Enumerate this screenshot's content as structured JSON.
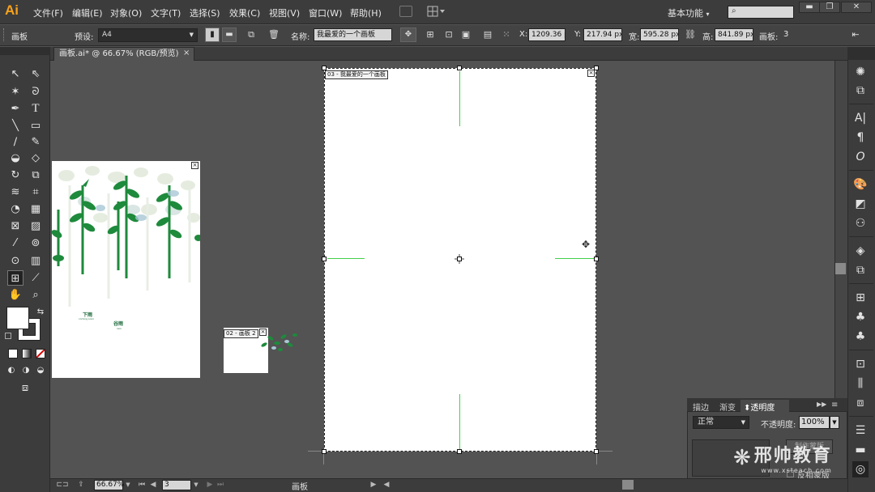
{
  "app": {
    "logo": "Ai"
  },
  "menu": [
    "文件(F)",
    "编辑(E)",
    "对象(O)",
    "文字(T)",
    "选择(S)",
    "效果(C)",
    "视图(V)",
    "窗口(W)",
    "帮助(H)"
  ],
  "workspace": "基本功能",
  "search": {
    "placeholder": ""
  },
  "window_controls": {
    "minimize": "▬",
    "maximize": "❐",
    "close": "✕"
  },
  "control_bar": {
    "mode": "画板",
    "preset_label": "预设:",
    "preset_value": "A4",
    "name_label": "名称:",
    "name_value": "我最爱的一个画板",
    "x_label": "X:",
    "x_value": "1209.36 px",
    "y_label": "Y:",
    "y_value": "217.94 px",
    "w_label": "宽:",
    "w_value": "595.28 px",
    "h_label": "高:",
    "h_value": "841.89 px",
    "count_label": "画板:",
    "count_value": "3"
  },
  "document_tab": {
    "title": "画板.ai* @ 66.67% (RGB/预览)",
    "close": "×"
  },
  "artboards": {
    "a1": {
      "title_cn": "下雨",
      "subtitle": "coming soon",
      "title_cn_2": "谷雨",
      "caption": "rain"
    },
    "a2": {
      "label": "02 - 画板 2"
    },
    "a3": {
      "label": "03 - 我最爱的一个画板"
    },
    "close": "×"
  },
  "transparency_panel": {
    "tabs": [
      "描边",
      "渐变",
      "透明度"
    ],
    "blend_mode": "正常",
    "opacity_label": "不透明度:",
    "opacity_value": "100%",
    "mask_button": "制作蒙版",
    "invert_label": "反相蒙版"
  },
  "watermark": {
    "name": "邢帅教育",
    "url": "www.xsteach.com"
  },
  "status_bar": {
    "zoom": "66.67%",
    "page": "3",
    "label": "画板"
  },
  "colors": {
    "accent": "#f7a21b",
    "guide_green": "#44d04a",
    "leaf_green": "#1e8a3c"
  }
}
